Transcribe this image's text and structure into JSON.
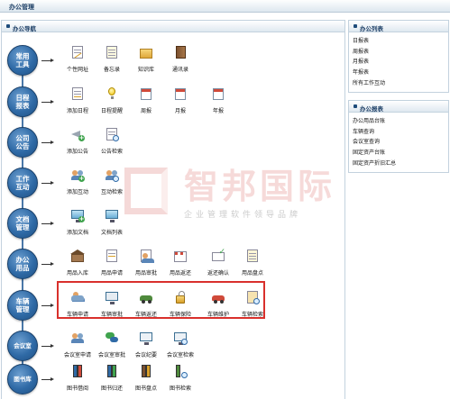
{
  "window": {
    "title": "办公管理"
  },
  "nav": {
    "title": "办公导航"
  },
  "side_panels": [
    {
      "title": "办公列表",
      "items": [
        "日报表",
        "周报表",
        "月报表",
        "年报表",
        "所有工作互动"
      ]
    },
    {
      "title": "办公报表",
      "items": [
        "办公用品台账",
        "车辆查询",
        "会议室查询",
        "固定资产台账",
        "固定资产折旧汇总"
      ]
    }
  ],
  "categories": [
    {
      "label": "常用\n工具",
      "items": [
        {
          "label": "个性网址",
          "icon": "pencil-page-icon"
        },
        {
          "label": "备忘录",
          "icon": "memo-icon"
        },
        {
          "label": "知识库",
          "icon": "folder-icon"
        },
        {
          "label": "通讯录",
          "icon": "address-book-icon"
        }
      ]
    },
    {
      "label": "日程\n报表",
      "items": [
        {
          "label": "添加日程",
          "icon": "pencil-page-icon"
        },
        {
          "label": "日程提醒",
          "icon": "bulb-icon"
        },
        {
          "label": "周报",
          "icon": "calendar-icon"
        },
        {
          "label": "月报",
          "icon": "calendar-icon"
        },
        {
          "label": "年报",
          "icon": "calendar-icon"
        }
      ]
    },
    {
      "label": "公司\n公告",
      "items": [
        {
          "label": "添加公告",
          "icon": "megaphone-icon"
        },
        {
          "label": "公告检索",
          "icon": "search-page-icon"
        }
      ]
    },
    {
      "label": "工作\n互动",
      "items": [
        {
          "label": "添加互动",
          "icon": "people-add-icon"
        },
        {
          "label": "互动检索",
          "icon": "people-search-icon"
        }
      ]
    },
    {
      "label": "文档\n管理",
      "items": [
        {
          "label": "添加文档",
          "icon": "monitor-add-icon"
        },
        {
          "label": "文档列表",
          "icon": "monitor-icon"
        }
      ]
    },
    {
      "label": "办公\n用品",
      "items": [
        {
          "label": "用品入库",
          "icon": "warehouse-icon"
        },
        {
          "label": "用品申请",
          "icon": "edit-page-icon"
        },
        {
          "label": "用品审批",
          "icon": "approve-icon"
        },
        {
          "label": "用品返还",
          "icon": "store-icon"
        },
        {
          "label": "返还确认",
          "icon": "mail-check-icon"
        },
        {
          "label": "用品盘点",
          "icon": "inventory-icon"
        }
      ]
    },
    {
      "label": "车辆\n管理",
      "items": [
        {
          "label": "车辆申请",
          "icon": "car-apply-icon"
        },
        {
          "label": "车辆审批",
          "icon": "car-approve-icon"
        },
        {
          "label": "车辆返还",
          "icon": "truck-return-icon"
        },
        {
          "label": "车辆保险",
          "icon": "lock-icon"
        },
        {
          "label": "车辆维护",
          "icon": "car-repair-icon"
        },
        {
          "label": "车辆检索",
          "icon": "car-search-icon"
        }
      ]
    },
    {
      "label": "会议室",
      "items": [
        {
          "label": "会议室申请",
          "icon": "meeting-apply-icon"
        },
        {
          "label": "会议室审批",
          "icon": "chat-icon"
        },
        {
          "label": "会议纪要",
          "icon": "minutes-icon"
        },
        {
          "label": "会议室检索",
          "icon": "meeting-search-icon"
        }
      ]
    },
    {
      "label": "图书库",
      "items": [
        {
          "label": "图书借阅",
          "icon": "book-borrow-icon"
        },
        {
          "label": "图书归还",
          "icon": "book-return-icon"
        },
        {
          "label": "图书盘点",
          "icon": "book-inventory-icon"
        },
        {
          "label": "图书检索",
          "icon": "book-search-icon"
        }
      ]
    }
  ],
  "watermark": {
    "title": "智邦国际",
    "subtitle": "企业管理软件领导品牌"
  },
  "colors": {
    "accent": "#2f6aa6",
    "highlight": "#d9302c"
  }
}
